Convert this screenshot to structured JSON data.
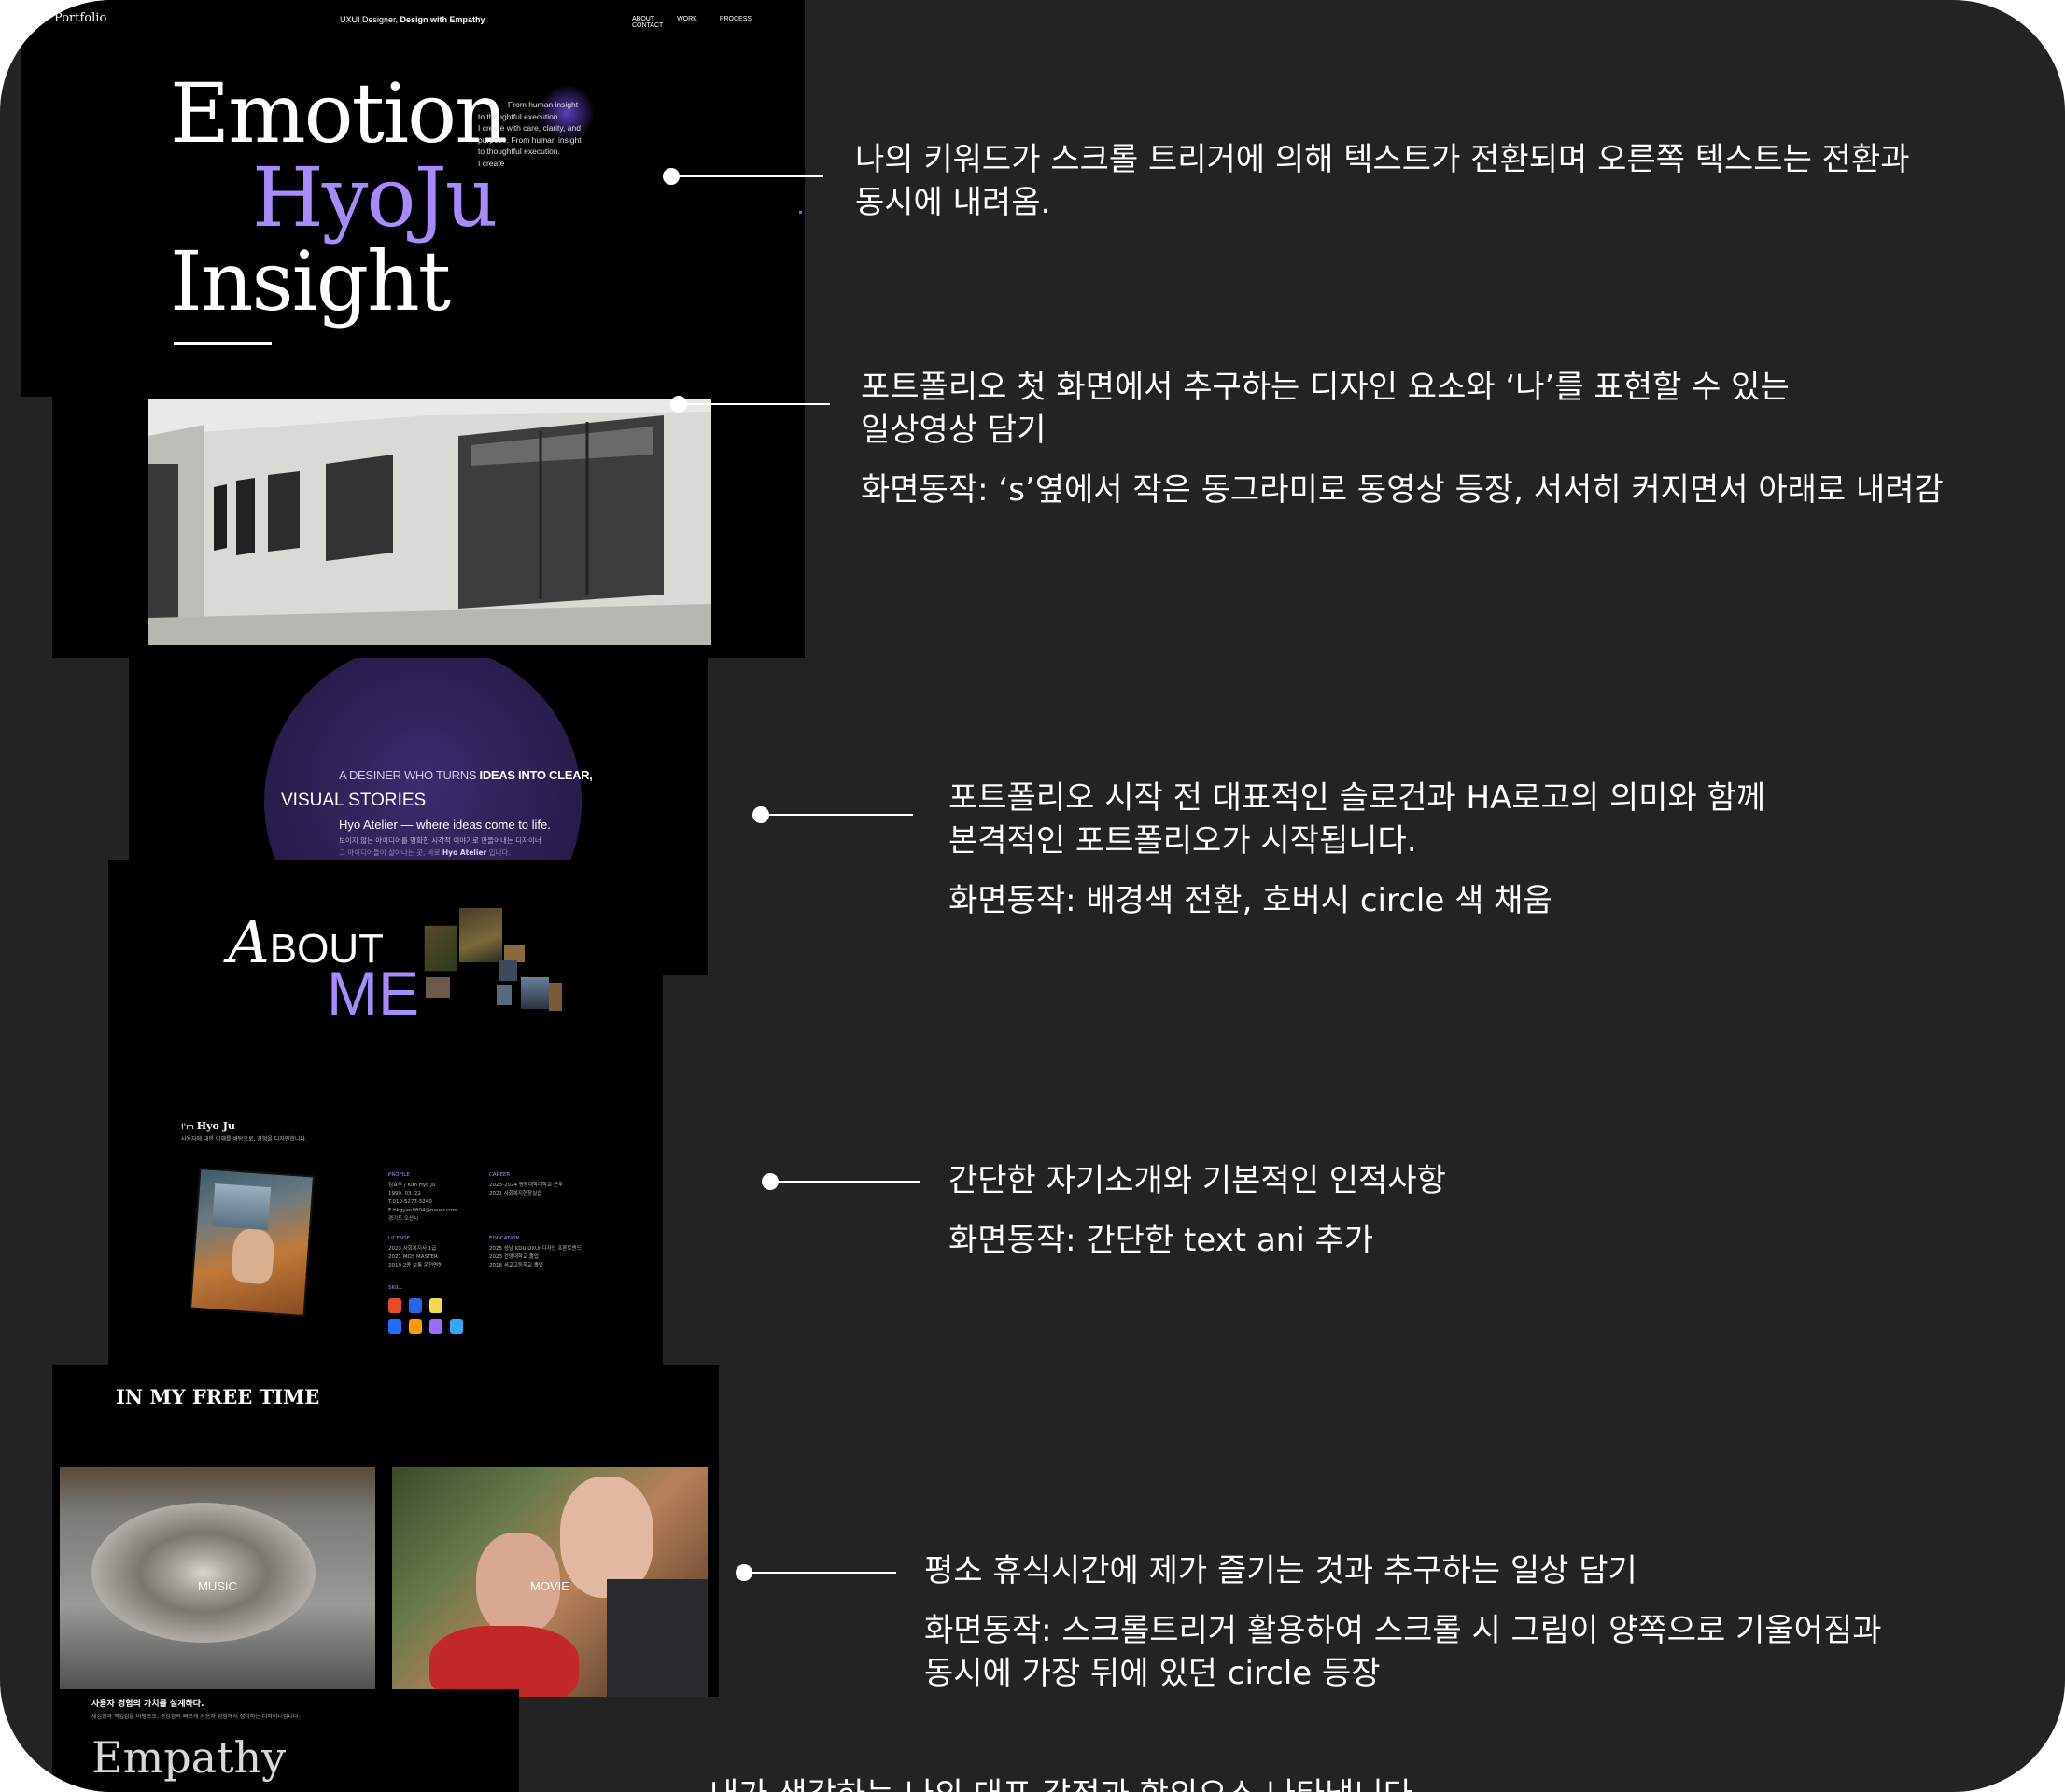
{
  "hero": {
    "logo": "Portfolio",
    "tagline_prefix": "UXUI Designer, ",
    "tagline_bold": "Design with Empathy",
    "nav": [
      "ABOUT",
      "WORK",
      "PROCESS",
      "CONTACT"
    ],
    "words": [
      "Emotion",
      "HyoJu",
      "Insight"
    ],
    "side_text": [
      "From human insight",
      "to thoughtful execution.",
      "I create  with care, clarity, and",
      "purpose. From human insight",
      "to thoughtful execution.",
      "I create"
    ]
  },
  "slogan": {
    "line1_prefix": "A DESINER WHO TURNS ",
    "line1_bold": "IDEAS INTO CLEAR,",
    "line2": "VISUAL STORIES",
    "line3": "Hyo Atelier — where ideas come to life.",
    "line4": "보이지 않는 아이디어를 명확한 시각적 이야기로 만들어내는 디자이너",
    "line5_prefix": "그 아이디어들이 살아나는 곳, 바로 ",
    "line5_bold": "Hyo Atelier",
    "line5_suffix": " 입니다."
  },
  "about": {
    "title_cap": "A",
    "title_rest": "BOUT",
    "title_me": "ME"
  },
  "profile": {
    "intro_prefix": "I'm ",
    "intro_name": "Hyo Ju",
    "intro_sub": "사용자에 대한 이해를 바탕으로, 경험을 디자인합니다.",
    "blocks": [
      {
        "title": "PROFILE",
        "lines": [
          "김효주 / Kim Hyo Ju",
          "1999. 03. 22",
          "T.010-5277-5240",
          "E.hkgyan9804@naver.com",
          "경기도 오산시"
        ]
      },
      {
        "title": "CAREER",
        "lines": [
          "2023-2024  평창대학대학교 근무",
          "2021  사회복지현장실습"
        ]
      },
      {
        "title": "LICENSE",
        "lines": [
          "2023  사회복지사 1급",
          "2021  MOS MASTER",
          "2019  2종 보통 운전면허"
        ]
      },
      {
        "title": "EDUCATION",
        "lines": [
          "2025  성남 KDU UXUI 디자인 프론트엔드",
          "2023  건양대학교 졸업",
          "2018  세교고등학교 졸업"
        ]
      },
      {
        "title": "SKILL",
        "lines": []
      }
    ],
    "skill_colors": [
      "#e44d26",
      "#2965f1",
      "#f0db4f",
      "#1e6fff",
      "#ff9a00",
      "#9a6bff",
      "#31a8ff"
    ]
  },
  "free_time": {
    "title": "IN MY FREE TIME",
    "cards": [
      "MUSIC",
      "MOVIE"
    ]
  },
  "empathy": {
    "heading": "사용자 경험의 가치를 설계하다.",
    "sub": "세심함과 책임감을 바탕으로, 공감함의 빠르게 사용자 경험에서 생각하는 디자이너입니다.",
    "word": "Empathy"
  },
  "annotations": [
    {
      "lines": [
        "나의 키워드가 스크롤 트리거에 의해 텍스트가 전환되며 오른쪽 텍스트는 전환과",
        "동시에 내려옴."
      ]
    },
    {
      "lines": [
        "포트폴리오 첫 화면에서 추구하는 디자인 요소와 ‘나’를 표현할 수 있는",
        "일상영상 담기"
      ],
      "action": "화면동작: ‘s’옆에서 작은 동그라미로 동영상 등장, 서서히 커지면서 아래로 내려감"
    },
    {
      "lines": [
        "포트폴리오 시작 전 대표적인 슬로건과 HA로고의 의미와 함께",
        "본격적인 포트폴리오가 시작됩니다."
      ],
      "action": "화면동작: 배경색 전환, 호버시 circle 색 채움"
    },
    {
      "lines": [
        "간단한 자기소개와 기본적인 인적사항"
      ],
      "action": "화면동작: 간단한 text ani 추가"
    },
    {
      "lines": [
        "평소 휴식시간에 제가 즐기는 것과  추구하는 일상 담기"
      ],
      "action": "화면동작: 스크롤트리거 활용하여 스크롤 시 그림이 양쪽으로 기울어짐과",
      "action2": "동시에 가장 뒤에 있던 circle 등장"
    },
    {
      "lines": [
        "내가 생각하는 나의 대표 감정과 함의으스 나타냄니다"
      ]
    }
  ],
  "colors": {
    "accent": "#a78bfa",
    "frame": "#232323",
    "slogan_circle": "#2b1f4e"
  }
}
